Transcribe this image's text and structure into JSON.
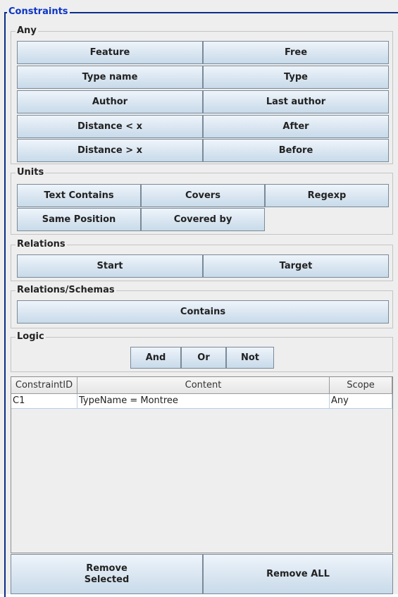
{
  "panel": {
    "title": "Constraints"
  },
  "any": {
    "title": "Any",
    "buttons": [
      "Feature",
      "Free",
      "Type name",
      "Type",
      "Author",
      "Last author",
      "Distance < x",
      "After",
      "Distance > x",
      "Before"
    ]
  },
  "units": {
    "title": "Units",
    "buttons": [
      "Text Contains",
      "Covers",
      "Regexp",
      "Same Position",
      "Covered by"
    ]
  },
  "relations": {
    "title": "Relations",
    "buttons": [
      "Start",
      "Target"
    ]
  },
  "relations_schemas": {
    "title": "Relations/Schemas",
    "buttons": [
      "Contains"
    ]
  },
  "logic": {
    "title": "Logic",
    "buttons": [
      "And",
      "Or",
      "Not"
    ]
  },
  "table": {
    "columns": [
      "ConstraintID",
      "Content",
      "Scope"
    ],
    "rows": [
      [
        "C1",
        "TypeName = Montree",
        "Any"
      ]
    ]
  },
  "footer": {
    "remove_selected_line1": "Remove",
    "remove_selected_line2": "Selected",
    "remove_all": "Remove ALL"
  }
}
